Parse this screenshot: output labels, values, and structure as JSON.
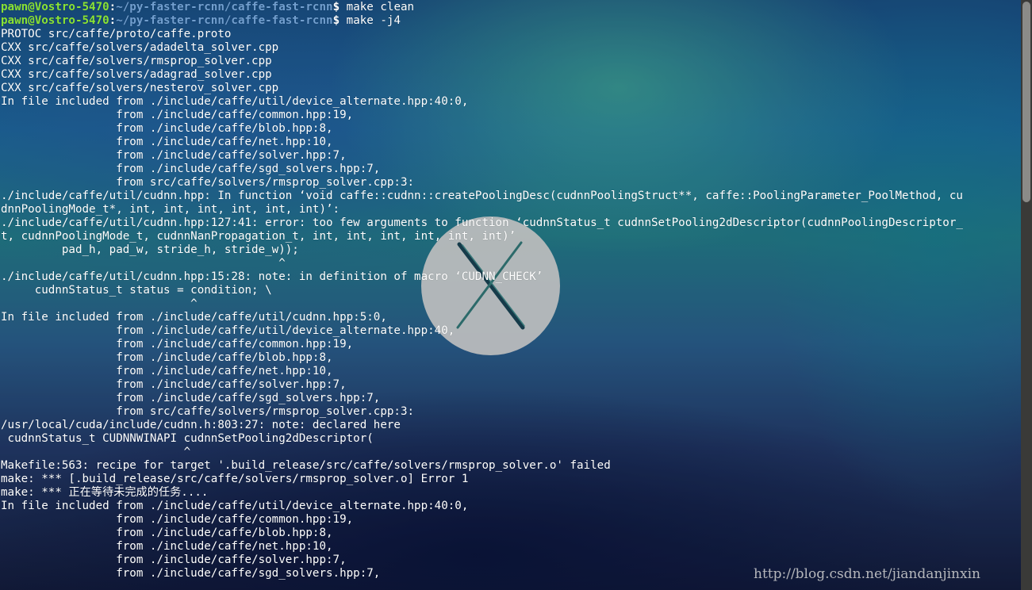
{
  "terminal": {
    "prompt": {
      "user_host": "pawn@Vostro-5470",
      "separator": ":",
      "path": "~/py-faster-rcnn/caffe-fast-rcnn",
      "symbol": "$"
    },
    "commands": [
      "make clean",
      "make -j4"
    ],
    "output": [
      "PROTOC src/caffe/proto/caffe.proto",
      "CXX src/caffe/solvers/adadelta_solver.cpp",
      "CXX src/caffe/solvers/rmsprop_solver.cpp",
      "CXX src/caffe/solvers/adagrad_solver.cpp",
      "CXX src/caffe/solvers/nesterov_solver.cpp",
      "In file included from ./include/caffe/util/device_alternate.hpp:40:0,",
      "                 from ./include/caffe/common.hpp:19,",
      "                 from ./include/caffe/blob.hpp:8,",
      "                 from ./include/caffe/net.hpp:10,",
      "                 from ./include/caffe/solver.hpp:7,",
      "                 from ./include/caffe/sgd_solvers.hpp:7,",
      "                 from src/caffe/solvers/rmsprop_solver.cpp:3:",
      "./include/caffe/util/cudnn.hpp: In function ‘void caffe::cudnn::createPoolingDesc(cudnnPoolingStruct**, caffe::PoolingParameter_PoolMethod, cu",
      "dnnPoolingMode_t*, int, int, int, int, int, int)’:",
      "./include/caffe/util/cudnn.hpp:127:41: error: too few arguments to function ‘cudnnStatus_t cudnnSetPooling2dDescriptor(cudnnPoolingDescriptor_",
      "t, cudnnPoolingMode_t, cudnnNanPropagation_t, int, int, int, int, int, int)’",
      "         pad_h, pad_w, stride_h, stride_w));",
      "                                         ^",
      "./include/caffe/util/cudnn.hpp:15:28: note: in definition of macro ‘CUDNN_CHECK’",
      "     cudnnStatus_t status = condition; \\",
      "                            ^",
      "In file included from ./include/caffe/util/cudnn.hpp:5:0,",
      "                 from ./include/caffe/util/device_alternate.hpp:40,",
      "                 from ./include/caffe/common.hpp:19,",
      "                 from ./include/caffe/blob.hpp:8,",
      "                 from ./include/caffe/net.hpp:10,",
      "                 from ./include/caffe/solver.hpp:7,",
      "                 from ./include/caffe/sgd_solvers.hpp:7,",
      "                 from src/caffe/solvers/rmsprop_solver.cpp:3:",
      "/usr/local/cuda/include/cudnn.h:803:27: note: declared here",
      " cudnnStatus_t CUDNNWINAPI cudnnSetPooling2dDescriptor(",
      "                           ^",
      "Makefile:563: recipe for target '.build_release/src/caffe/solvers/rmsprop_solver.o' failed",
      "make: *** [.build_release/src/caffe/solvers/rmsprop_solver.o] Error 1",
      "make: *** 正在等待未完成的任务....",
      "In file included from ./include/caffe/util/device_alternate.hpp:40:0,",
      "                 from ./include/caffe/common.hpp:19,",
      "                 from ./include/caffe/blob.hpp:8,",
      "                 from ./include/caffe/net.hpp:10,",
      "                 from ./include/caffe/solver.hpp:7,",
      "                 from ./include/caffe/sgd_solvers.hpp:7,"
    ]
  },
  "logo_icon": "os-x-logo-icon",
  "watermark": "http://blog.csdn.net/jiandanjinxin",
  "colors": {
    "prompt_user": "#8ae234",
    "prompt_path": "#729fcf",
    "text": "#ffffff",
    "scrollbar_thumb": "#8b8b88"
  }
}
